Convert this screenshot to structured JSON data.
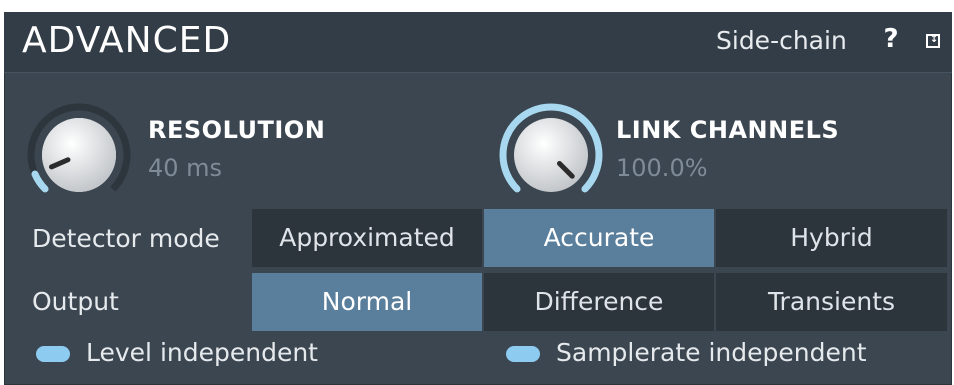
{
  "header": {
    "title": "ADVANCED",
    "sidechain_label": "Side-chain",
    "help_label": "?",
    "expand_icon": "expand-icon"
  },
  "knobs": [
    {
      "label": "RESOLUTION",
      "value": "40 ms",
      "level": 0.08
    },
    {
      "label": "LINK CHANNELS",
      "value": "100.0%",
      "level": 1.0
    }
  ],
  "detector_mode": {
    "label": "Detector mode",
    "options": [
      "Approximated",
      "Accurate",
      "Hybrid"
    ],
    "selected": "Accurate"
  },
  "output": {
    "label": "Output",
    "options": [
      "Normal",
      "Difference",
      "Transients"
    ],
    "selected": "Normal"
  },
  "toggles": [
    {
      "label": "Level independent",
      "on": true
    },
    {
      "label": "Samplerate independent",
      "on": true
    }
  ],
  "colors": {
    "panel": "#3b4651",
    "active_segment": "#5a7f9c",
    "toggle": "#8ecbf0",
    "knob_arc": "#a8d8f0"
  }
}
